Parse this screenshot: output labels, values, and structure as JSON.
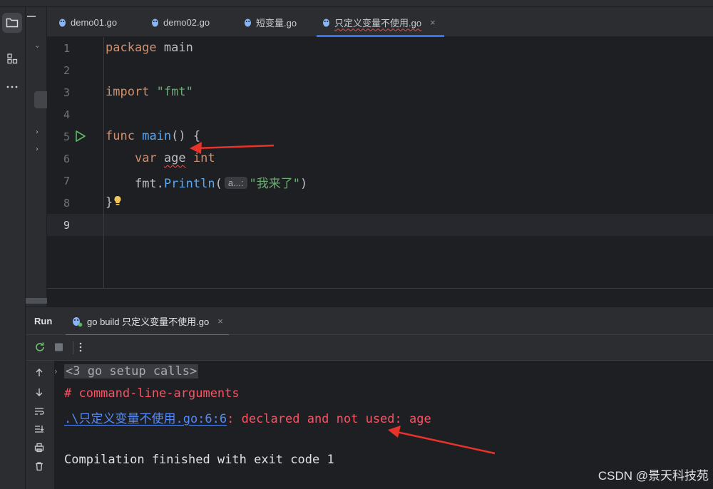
{
  "tabs": [
    {
      "label": "demo01.go",
      "active": false
    },
    {
      "label": "demo02.go",
      "active": false
    },
    {
      "label": "短变量.go",
      "active": false
    },
    {
      "label": "只定义变量不使用.go",
      "active": true,
      "close": "×"
    }
  ],
  "editor": {
    "line_numbers": [
      "1",
      "2",
      "3",
      "4",
      "5",
      "6",
      "7",
      "8",
      "9"
    ],
    "current_line": "9",
    "line1": {
      "kw": "package",
      "name": "main"
    },
    "line3": {
      "kw": "import",
      "str": "\"fmt\""
    },
    "line5": {
      "kw": "func",
      "fn": "main",
      "rest": "() {"
    },
    "line6": {
      "kw": "var",
      "name": "age",
      "type": "int"
    },
    "line7": {
      "pkg": "fmt.",
      "fn": "Println",
      "open": "(",
      "hint": "a...:",
      "str": "\"我来了\"",
      "close": ")"
    },
    "line8": {
      "text": "}"
    }
  },
  "run_panel": {
    "title": "Run",
    "tab_label": "go build 只定义变量不使用.go",
    "tab_close": "×",
    "console": {
      "collapsed": "<3 go setup calls>",
      "line2": "# command-line-arguments",
      "link": ".\\只定义变量不使用.go:6:6",
      "error": ": declared and not used: age",
      "line5": "Compilation finished with exit code 1"
    }
  },
  "watermark": "CSDN @景天科技苑",
  "colors": {
    "accent": "#3574f0",
    "error": "#f75464",
    "annotation_arrow": "#e8332a"
  }
}
